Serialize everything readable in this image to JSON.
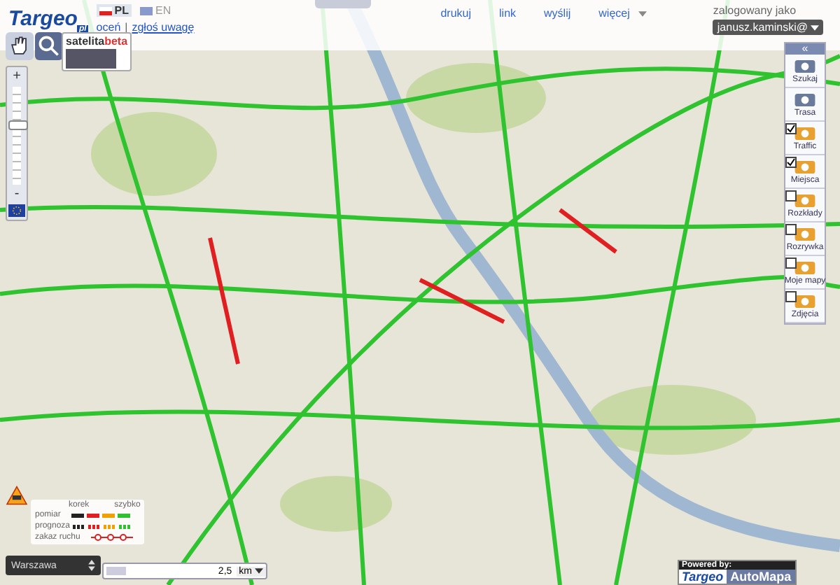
{
  "header": {
    "logo": "Targeo",
    "logo_suffix": "pl",
    "languages": [
      {
        "code": "PL",
        "selected": true
      },
      {
        "code": "EN",
        "selected": false
      }
    ],
    "links": [
      "oceń",
      "zgłoś uwagę"
    ],
    "separator": "|",
    "toolbar": [
      "drukuj",
      "link",
      "wyślij",
      "więcej"
    ],
    "login_label": "zalogowany jako",
    "user": "janusz.kaminski@"
  },
  "map_type": {
    "label": "satelita",
    "badge": "beta"
  },
  "zoom": {
    "plus": "+",
    "minus": "-",
    "level": 0.62
  },
  "panel": {
    "collapse": "«",
    "items": [
      {
        "kind": "tool",
        "label": "Szukaj"
      },
      {
        "kind": "tool",
        "label": "Trasa"
      },
      {
        "kind": "layer",
        "label": "Traffic",
        "checked": true
      },
      {
        "kind": "layer",
        "label": "Miejsca",
        "checked": true
      },
      {
        "kind": "layer",
        "label": "Rozkłady",
        "checked": false
      },
      {
        "kind": "layer",
        "label": "Rozrywka",
        "checked": false
      },
      {
        "kind": "layer",
        "label": "Moje mapy",
        "checked": false
      },
      {
        "kind": "layer",
        "label": "Zdjęcia",
        "checked": false
      }
    ]
  },
  "legend": {
    "slow": "korek",
    "fast": "szybko",
    "rows": [
      {
        "kind": "measured",
        "label": "pomiar",
        "swatches": [
          {
            "color": "#222222"
          },
          {
            "color": "#e02020"
          },
          {
            "color": "#f0a000"
          },
          {
            "color": "#30c030"
          }
        ]
      },
      {
        "kind": "forecast",
        "label": "prognoza",
        "swatches": [
          {
            "color": "#222222"
          },
          {
            "color": "#e02020"
          },
          {
            "color": "#f0a000"
          },
          {
            "color": "#30c030"
          }
        ]
      },
      {
        "kind": "closed",
        "label": "zakaz ruchu"
      }
    ]
  },
  "city": {
    "value": "Warszawa"
  },
  "scale": {
    "value": "2,5",
    "unit": "km"
  },
  "powered": {
    "label": "Powered by:",
    "brand1": "Targeo",
    "brand2": "AutoMapa"
  }
}
